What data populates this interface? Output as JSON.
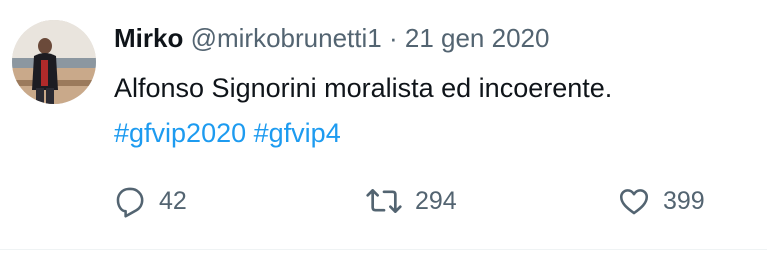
{
  "tweet": {
    "author": {
      "name": "Mirko",
      "handle": "@mirkobrunetti1",
      "separator": "·",
      "date": "21 gen 2020"
    },
    "text": "Alfonso Signorini moralista ed incoerente.",
    "hashtags": [
      "#gfvip2020",
      "#gfvip4"
    ],
    "stats": {
      "replies": "42",
      "retweets": "294",
      "likes": "399"
    },
    "icons": {
      "reply": "reply-icon",
      "retweet": "retweet-icon",
      "like": "heart-icon"
    },
    "colors": {
      "text": "#0f1419",
      "muted": "#536471",
      "link": "#1d9bf0"
    }
  }
}
